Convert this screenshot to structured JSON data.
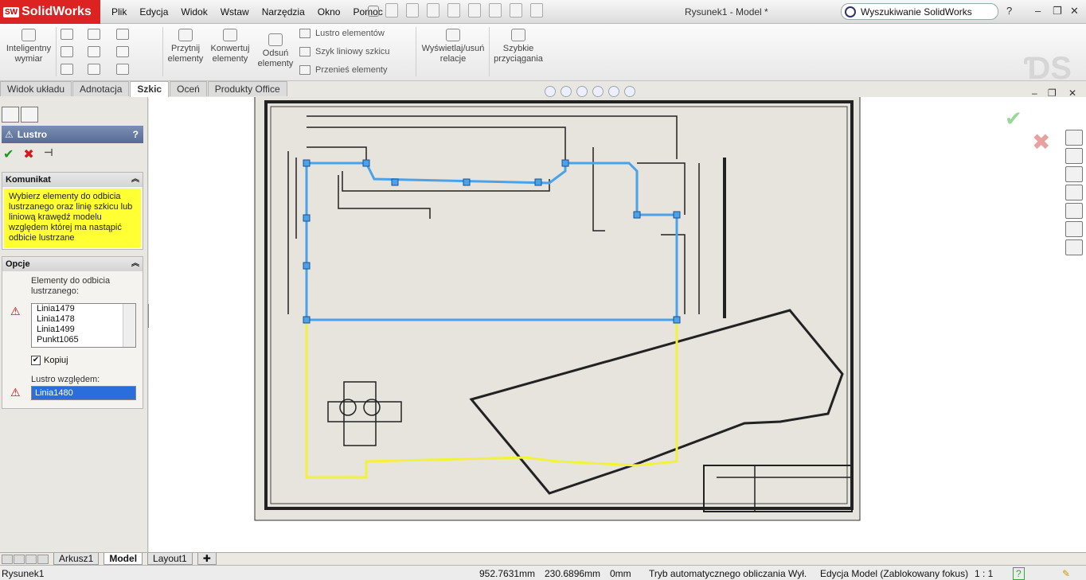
{
  "app": {
    "name": "SolidWorks",
    "logo_badge": "SW",
    "doc_title": "Rysunek1 - Model *"
  },
  "menu": [
    "Plik",
    "Edycja",
    "Widok",
    "Wstaw",
    "Narzędzia",
    "Okno",
    "Pomoc"
  ],
  "search": {
    "placeholder": "Wyszukiwanie SolidWorks"
  },
  "window_controls": {
    "help": "?",
    "minimize": "–",
    "restore": "❐",
    "close": "✕"
  },
  "ribbon": {
    "smart_dimension": "Inteligentny wymiar",
    "trim": "Przytnij elementy",
    "convert": "Konwertuj elementy",
    "offset": "Odsuń elementy",
    "mirror": "Lustro elementów",
    "linear_pattern": "Szyk liniowy szkicu",
    "move": "Przenieś elementy",
    "relations": "Wyświetlaj/usuń relacje",
    "snaps": "Szybkie przyciągania"
  },
  "tabs": [
    "Widok układu",
    "Adnotacja",
    "Szkic",
    "Oceń",
    "Produkty Office"
  ],
  "active_tab": "Szkic",
  "pm": {
    "title": "Lustro",
    "help": "?",
    "message_header": "Komunikat",
    "message": "Wybierz elementy do odbicia lustrzanego oraz linię szkicu lub liniową krawędź modelu względem której ma nastąpić odbicie lustrzane",
    "options_header": "Opcje",
    "entities_label": "Elementy do odbicia lustrzanego:",
    "entities": [
      "Linia1479",
      "Linia1478",
      "Linia1499",
      "Punkt1065"
    ],
    "copy_label": "Kopiuj",
    "copy_checked": true,
    "mirror_about_label": "Lustro względem:",
    "mirror_about_value": "Linia1480"
  },
  "sheet_tabs": [
    "Arkusz1",
    "Model",
    "Layout1"
  ],
  "active_sheet": "Model",
  "status": {
    "doc": "Rysunek1",
    "x": "952.7631mm",
    "y": "230.6896mm",
    "z": "0mm",
    "mode": "Tryb automatycznego obliczania Wył.",
    "edit": "Edycja Model (Zablokowany fokus)",
    "scale": "1 : 1",
    "help": "?"
  },
  "colors": {
    "selected": "#4aa3ea",
    "preview": "#f2f23c",
    "pm_header": "#5f739d",
    "message_bg": "#ffff33"
  }
}
